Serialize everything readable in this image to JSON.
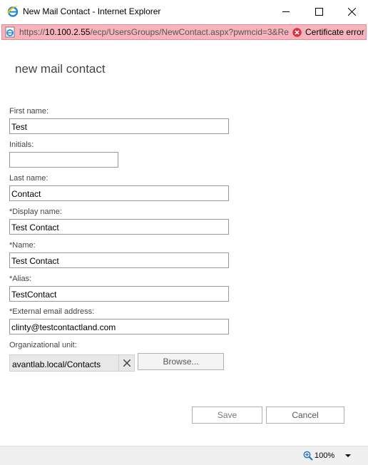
{
  "window": {
    "title": "New Mail Contact - Internet Explorer",
    "url_prefix": "https://",
    "url_host": "10.100.2.55",
    "url_path": "/ecp/UsersGroups/NewContact.aspx?pwmcid=3&Re",
    "certificate_label": "Certificate error",
    "zoom": "100%"
  },
  "form": {
    "title": "new mail contact",
    "first_name": {
      "label": "First name:",
      "value": "Test"
    },
    "initials": {
      "label": "Initials:",
      "value": ""
    },
    "last_name": {
      "label": "Last name:",
      "value": "Contact"
    },
    "display_name": {
      "label": "*Display name:",
      "value": "Test Contact"
    },
    "name": {
      "label": "*Name:",
      "value": "Test Contact"
    },
    "alias": {
      "label": "*Alias:",
      "value": "TestContact"
    },
    "external_email": {
      "label": "*External email address:",
      "value": "clinty@testcontactland.com"
    },
    "org_unit": {
      "label": "Organizational unit:",
      "value": "avantlab.local/Contacts"
    },
    "browse_label": "Browse...",
    "save_label": "Save",
    "cancel_label": "Cancel"
  },
  "colors": {
    "address_bar_error": "#f8b4bc",
    "cert_error_icon": "#d9303e",
    "ie_blue": "#1e88d8"
  },
  "icons": [
    "ie-logo-icon",
    "minimize-icon",
    "maximize-icon",
    "close-icon",
    "ie-page-icon",
    "certificate-error-icon",
    "clear-icon",
    "zoom-icon",
    "chevron-down-icon"
  ]
}
